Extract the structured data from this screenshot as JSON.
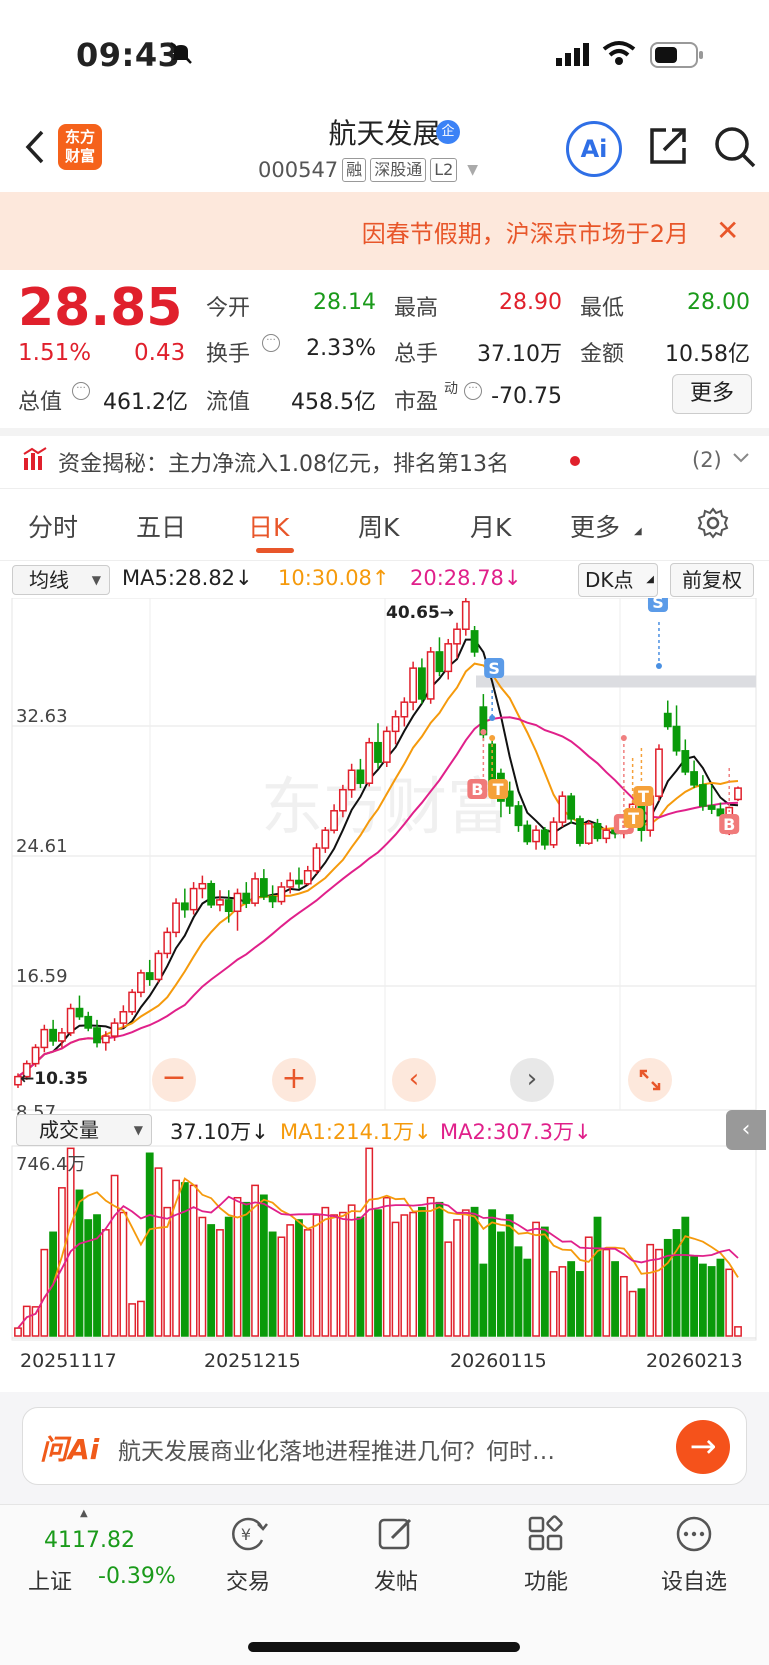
{
  "status": {
    "time": "09:43"
  },
  "header": {
    "logo_text": "东方财富",
    "stock_name": "航天发展",
    "qi_badge": "企",
    "code": "000547",
    "tags": [
      "融",
      "深股通",
      "L2"
    ],
    "ai_label": "Ai"
  },
  "notice": {
    "text": "因春节假期，沪深京市场于2月"
  },
  "quote": {
    "price": "28.85",
    "change_pct": "1.51%",
    "change": "0.43",
    "fields": [
      {
        "label": "今开",
        "value": "28.14",
        "color": "green"
      },
      {
        "label": "最高",
        "value": "28.90",
        "color": "red"
      },
      {
        "label": "最低",
        "value": "28.00",
        "color": "green"
      },
      {
        "label": "换手",
        "value": "2.33%",
        "color": "black"
      },
      {
        "label": "总手",
        "value": "37.10万",
        "color": "black"
      },
      {
        "label": "金额",
        "value": "10.58亿",
        "color": "black"
      },
      {
        "label": "总值",
        "value": "461.2亿",
        "color": "black"
      },
      {
        "label": "流值",
        "value": "458.5亿",
        "color": "black"
      },
      {
        "label": "市盈",
        "value": "-70.75",
        "color": "black"
      }
    ],
    "pe_sup": "动",
    "more_label": "更多"
  },
  "fund": {
    "text": "资金揭秘：主力净流入1.08亿元，排名第13名",
    "count": "(2)"
  },
  "tabs": [
    "分时",
    "五日",
    "日K",
    "周K",
    "月K",
    "更多"
  ],
  "active_tab": "日K",
  "ma_row": {
    "select": "均线",
    "ma5": "MA5:28.82↓",
    "ma10": "10:30.08↑",
    "ma20": "20:28.78↓",
    "dk": "DK点",
    "fq": "前复权"
  },
  "chart_data": {
    "type": "candlestick",
    "y_ticks": [
      "40.65",
      "32.63",
      "24.61",
      "16.59",
      "8.57"
    ],
    "ylim": [
      8.57,
      40.65
    ],
    "high_label": "40.65→",
    "low_label": "←10.35",
    "marker_labels": [
      "S",
      "S",
      "B",
      "T",
      "B",
      "T",
      "T",
      "B"
    ],
    "colors": {
      "up": "#e0202c",
      "down": "#0a9a0a",
      "ma5": "#111111",
      "ma10": "#f59a0c",
      "ma20": "#e0208a"
    },
    "candles": [
      [
        10.5,
        11.2,
        10.3,
        11.0
      ],
      [
        11.0,
        12.0,
        10.8,
        11.8
      ],
      [
        11.8,
        13.0,
        11.6,
        12.8
      ],
      [
        12.8,
        14.2,
        12.5,
        13.9
      ],
      [
        13.9,
        14.5,
        12.9,
        13.2
      ],
      [
        13.2,
        14.0,
        12.8,
        13.7
      ],
      [
        13.7,
        15.5,
        13.5,
        15.2
      ],
      [
        15.2,
        16.0,
        14.5,
        14.7
      ],
      [
        14.7,
        15.0,
        13.8,
        14.0
      ],
      [
        14.0,
        14.5,
        12.8,
        13.1
      ],
      [
        13.1,
        13.8,
        12.6,
        13.5
      ],
      [
        13.5,
        14.6,
        13.2,
        14.3
      ],
      [
        14.3,
        15.4,
        14.0,
        15.0
      ],
      [
        15.0,
        16.4,
        14.8,
        16.2
      ],
      [
        16.2,
        17.6,
        15.9,
        17.4
      ],
      [
        17.4,
        18.2,
        16.6,
        17.0
      ],
      [
        17.0,
        18.8,
        16.8,
        18.6
      ],
      [
        18.6,
        20.2,
        18.3,
        19.9
      ],
      [
        19.9,
        22.0,
        19.6,
        21.7
      ],
      [
        21.7,
        22.6,
        20.8,
        21.3
      ],
      [
        21.3,
        23.0,
        21.0,
        22.6
      ],
      [
        22.6,
        23.4,
        22.0,
        22.9
      ],
      [
        22.9,
        23.1,
        21.4,
        21.6
      ],
      [
        21.6,
        22.5,
        21.2,
        21.9
      ],
      [
        21.9,
        22.5,
        20.5,
        21.2
      ],
      [
        21.2,
        22.6,
        20.0,
        22.3
      ],
      [
        22.3,
        23.0,
        21.4,
        21.7
      ],
      [
        21.7,
        23.6,
        21.5,
        23.2
      ],
      [
        23.2,
        23.8,
        21.9,
        22.1
      ],
      [
        22.1,
        22.8,
        21.4,
        21.8
      ],
      [
        21.8,
        23.0,
        21.6,
        22.7
      ],
      [
        22.7,
        23.6,
        22.3,
        23.1
      ],
      [
        23.1,
        23.9,
        22.6,
        22.9
      ],
      [
        22.9,
        24.0,
        22.8,
        23.7
      ],
      [
        23.7,
        25.4,
        23.5,
        25.1
      ],
      [
        25.1,
        26.4,
        24.8,
        26.2
      ],
      [
        26.2,
        27.8,
        26.0,
        27.4
      ],
      [
        27.4,
        29.0,
        27.0,
        28.7
      ],
      [
        28.7,
        30.3,
        28.2,
        29.9
      ],
      [
        29.9,
        30.6,
        28.8,
        29.1
      ],
      [
        29.1,
        31.9,
        28.9,
        31.6
      ],
      [
        31.6,
        32.8,
        30.0,
        30.4
      ],
      [
        30.4,
        32.6,
        30.1,
        32.3
      ],
      [
        32.3,
        33.6,
        31.5,
        33.2
      ],
      [
        33.2,
        34.4,
        32.6,
        34.1
      ],
      [
        34.1,
        36.6,
        33.6,
        36.2
      ],
      [
        36.2,
        36.8,
        34.0,
        34.3
      ],
      [
        34.3,
        37.5,
        34.0,
        37.2
      ],
      [
        37.2,
        38.1,
        35.7,
        36.0
      ],
      [
        36.0,
        38.0,
        35.5,
        37.7
      ],
      [
        37.7,
        39.0,
        36.8,
        38.6
      ],
      [
        38.6,
        40.65,
        38.2,
        40.3
      ],
      [
        38.5,
        38.8,
        36.9,
        37.2
      ],
      [
        33.8,
        34.6,
        31.7,
        32.1
      ],
      [
        31.5,
        31.9,
        28.3,
        28.7
      ],
      [
        29.7,
        30.0,
        27.0,
        28.0
      ],
      [
        28.6,
        29.2,
        27.2,
        27.7
      ],
      [
        27.7,
        28.0,
        26.1,
        26.5
      ],
      [
        26.5,
        26.8,
        25.3,
        25.5
      ],
      [
        25.5,
        26.5,
        25.0,
        26.2
      ],
      [
        26.2,
        26.4,
        25.0,
        25.3
      ],
      [
        25.3,
        27.0,
        25.1,
        26.7
      ],
      [
        26.7,
        28.6,
        26.4,
        28.3
      ],
      [
        28.3,
        28.5,
        26.6,
        26.9
      ],
      [
        26.9,
        27.1,
        25.2,
        25.4
      ],
      [
        25.4,
        26.8,
        25.3,
        26.6
      ],
      [
        26.6,
        26.9,
        25.5,
        25.7
      ],
      [
        25.7,
        26.5,
        25.4,
        26.2
      ],
      [
        26.2,
        26.6,
        25.7,
        26.0
      ],
      [
        26.0,
        26.8,
        25.7,
        26.5
      ],
      [
        26.5,
        28.0,
        26.1,
        27.8
      ],
      [
        27.8,
        28.5,
        25.5,
        26.2
      ],
      [
        26.2,
        28.6,
        25.8,
        28.3
      ],
      [
        28.3,
        31.5,
        28.0,
        31.2
      ],
      [
        33.4,
        34.2,
        32.4,
        32.6
      ],
      [
        32.6,
        33.9,
        30.8,
        31.1
      ],
      [
        31.1,
        31.8,
        29.6,
        29.8
      ],
      [
        29.8,
        30.5,
        28.8,
        29.0
      ],
      [
        29.0,
        29.6,
        27.4,
        27.7
      ],
      [
        27.7,
        29.0,
        27.2,
        27.5
      ],
      [
        27.5,
        27.9,
        26.6,
        27.1
      ],
      [
        26.0,
        27.8,
        25.9,
        27.6
      ],
      [
        28.1,
        28.9,
        28.0,
        28.8
      ]
    ],
    "volumes": [
      32,
      120,
      118,
      350,
      420,
      600,
      760,
      590,
      470,
      490,
      430,
      650,
      500,
      130,
      140,
      740,
      680,
      520,
      630,
      620,
      610,
      480,
      450,
      430,
      480,
      560,
      540,
      610,
      570,
      420,
      400,
      450,
      470,
      430,
      490,
      520,
      490,
      500,
      530,
      480,
      760,
      510,
      560,
      460,
      490,
      500,
      520,
      560,
      540,
      380,
      470,
      510,
      520,
      290,
      510,
      420,
      490,
      360,
      310,
      460,
      440,
      260,
      280,
      300,
      260,
      400,
      480,
      350,
      300,
      240,
      180,
      190,
      370,
      350,
      390,
      430,
      480,
      320,
      290,
      280,
      310,
      270,
      37
    ],
    "volume_ymax": 746.4,
    "volume_top_label": "746.4万",
    "x_labels": [
      "20251117",
      "20251215",
      "20260115",
      "20260213"
    ]
  },
  "volume": {
    "select": "成交量",
    "value": "37.10万↓",
    "ma1": "MA1:214.1万↓",
    "ma2": "MA2:307.3万↓"
  },
  "watermark": "东方财富",
  "ask_ai": {
    "logo": "问Ai",
    "text": "航天发展商业化落地进程推进几何？何时…"
  },
  "bottom": {
    "index_value": "4117.82",
    "index_name": "上证",
    "index_change": "-0.39%",
    "items": [
      "交易",
      "发帖",
      "功能",
      "设自选"
    ]
  }
}
